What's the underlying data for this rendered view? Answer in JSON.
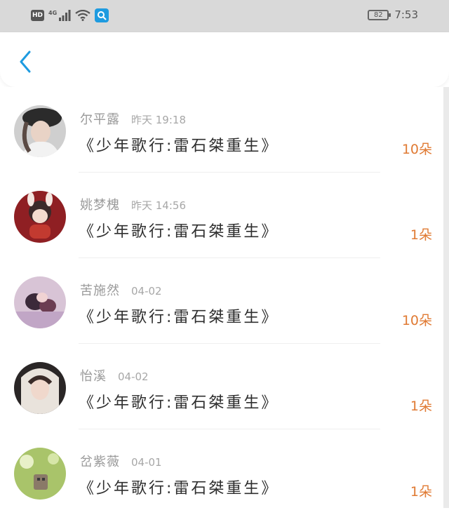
{
  "status_bar": {
    "hd": "HD",
    "network": "4G",
    "battery": "82",
    "time": "7:53"
  },
  "nav": {
    "back_icon": "chevron-left-icon"
  },
  "list": [
    {
      "name": "尔平露",
      "time": "昨天 19:18",
      "title": "《少年歌行:雷石桀重生》",
      "count": "10朵"
    },
    {
      "name": "姚梦槐",
      "time": "昨天 14:56",
      "title": "《少年歌行:雷石桀重生》",
      "count": "1朵"
    },
    {
      "name": "苦施然",
      "time": "04-02",
      "title": "《少年歌行:雷石桀重生》",
      "count": "10朵"
    },
    {
      "name": "怡溪",
      "time": "04-02",
      "title": "《少年歌行:雷石桀重生》",
      "count": "1朵"
    },
    {
      "name": "岔紫薇",
      "time": "04-01",
      "title": "《少年歌行:雷石桀重生》",
      "count": "1朵"
    }
  ],
  "colors": {
    "accent": "#1e9be0",
    "count": "#e07a33"
  }
}
